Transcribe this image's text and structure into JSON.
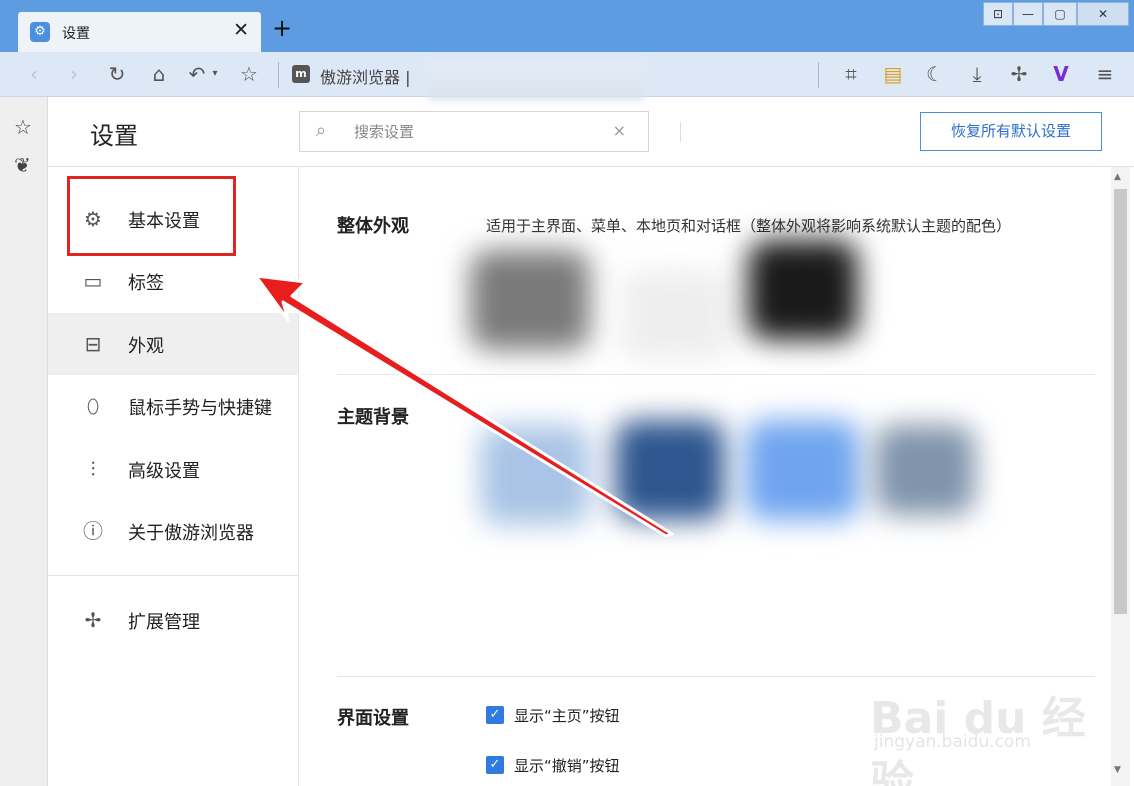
{
  "tab": {
    "title": "设置",
    "close": "✕",
    "new_tab": "+"
  },
  "window_controls": [
    "⊡",
    "—",
    "▢",
    "✕"
  ],
  "toolbar": {
    "site_name": "傲游浏览器",
    "site_sep": "|"
  },
  "header": {
    "title": "设置",
    "search_placeholder": "搜索设置",
    "search_clear": "×",
    "restore_button": "恢复所有默认设置"
  },
  "sidebar": {
    "items": [
      {
        "label": "基本设置",
        "icon": "gear-icon"
      },
      {
        "label": "标签",
        "icon": "tab-icon"
      },
      {
        "label": "外观",
        "icon": "window-icon"
      },
      {
        "label": "鼠标手势与快捷键",
        "icon": "mouse-icon"
      },
      {
        "label": "高级设置",
        "icon": "sliders-icon"
      },
      {
        "label": "关于傲游浏览器",
        "icon": "info-icon"
      }
    ],
    "extensions": {
      "label": "扩展管理",
      "icon": "puzzle-icon"
    }
  },
  "content": {
    "appearance": {
      "title": "整体外观",
      "description": "适用于主界面、菜单、本地页和对话框（整体外观将影响系统默认主题的配色）"
    },
    "theme_bg": {
      "title": "主题背景"
    },
    "ui_settings": {
      "title": "界面设置",
      "options": [
        {
          "label": "显示“主页”按钮",
          "checked": true
        },
        {
          "label": "显示“撤销”按钮",
          "checked": true
        }
      ]
    }
  },
  "watermark": {
    "brand": "Bai du 经验",
    "url": "jingyan.baidu.com"
  },
  "colors": {
    "tabbar": "#5d9ce0",
    "accent": "#2f7be0",
    "highlight": "#e02323"
  }
}
